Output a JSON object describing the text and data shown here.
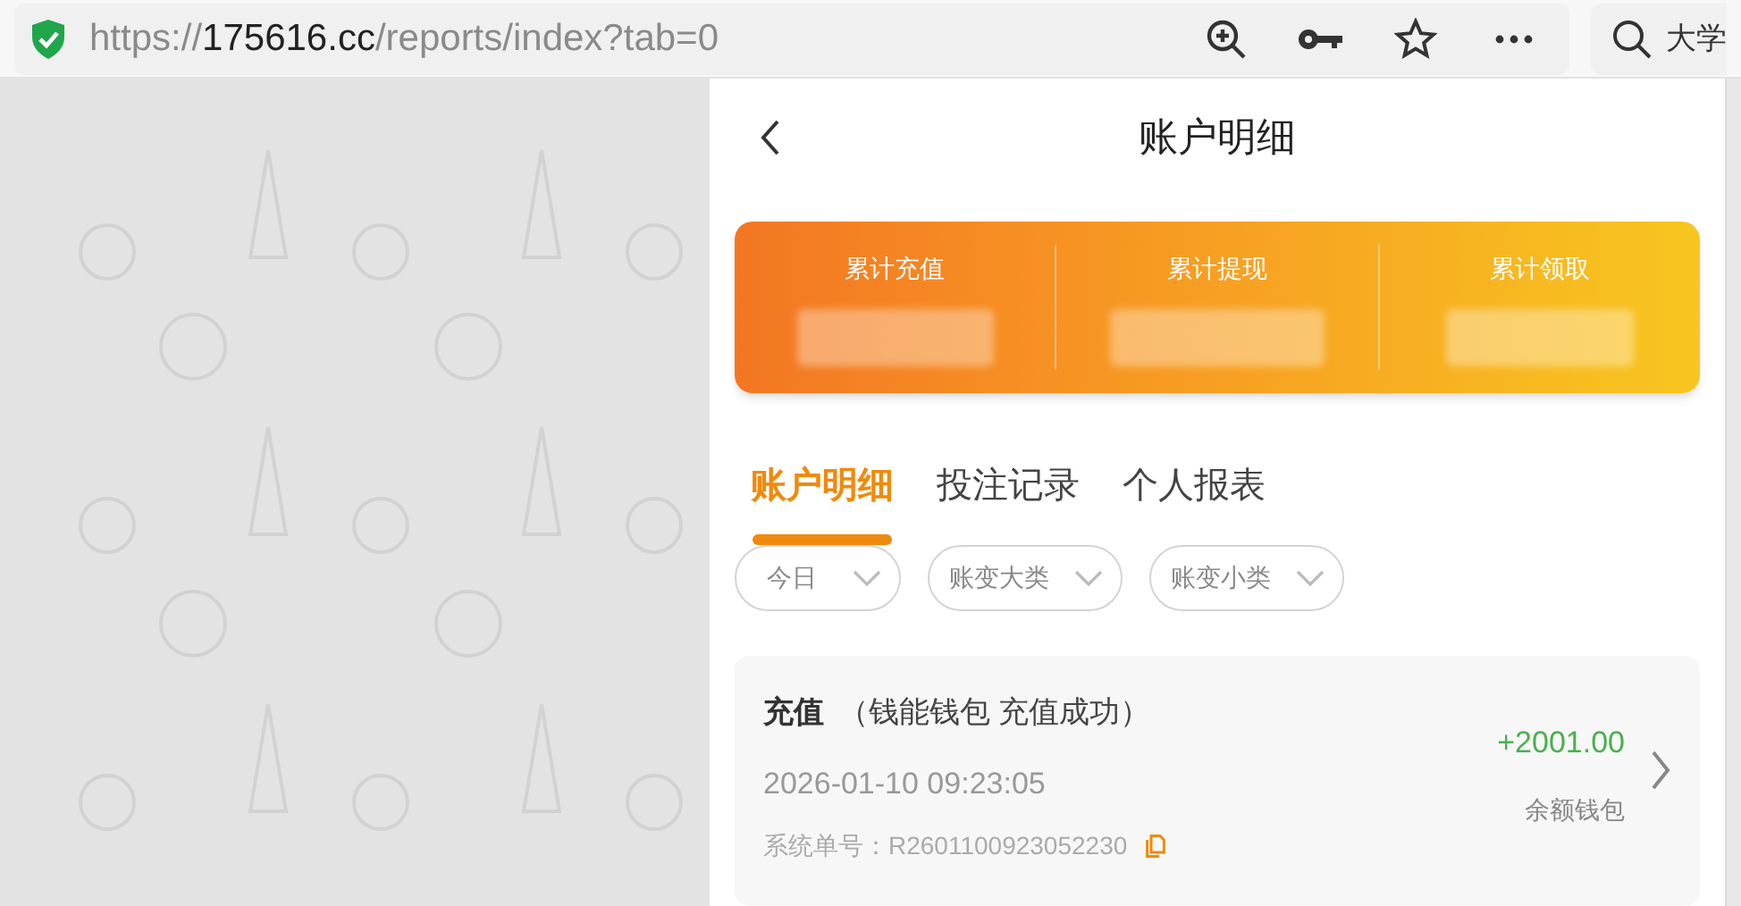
{
  "browser": {
    "url": {
      "scheme": "https://",
      "host": "175616.cc",
      "path": "/reports/index?tab=0"
    },
    "search": {
      "value": "大学"
    }
  },
  "page": {
    "title": "账户明细",
    "summary": [
      {
        "label": "累计充值"
      },
      {
        "label": "累计提现"
      },
      {
        "label": "累计领取"
      }
    ],
    "tabs": [
      {
        "label": "账户明细",
        "selected": true
      },
      {
        "label": "投注记录",
        "selected": false
      },
      {
        "label": "个人报表",
        "selected": false
      }
    ],
    "filters": [
      {
        "label": "今日"
      },
      {
        "label": "账变大类"
      },
      {
        "label": "账变小类"
      }
    ],
    "records": [
      {
        "type": "充值",
        "detail": "（钱能钱包 充值成功）",
        "time": "2026-01-10 09:23:05",
        "order_label": "系统单号：",
        "order_no": "R2601100923052230",
        "amount": "+2001.00",
        "wallet": "余额钱包"
      }
    ]
  }
}
